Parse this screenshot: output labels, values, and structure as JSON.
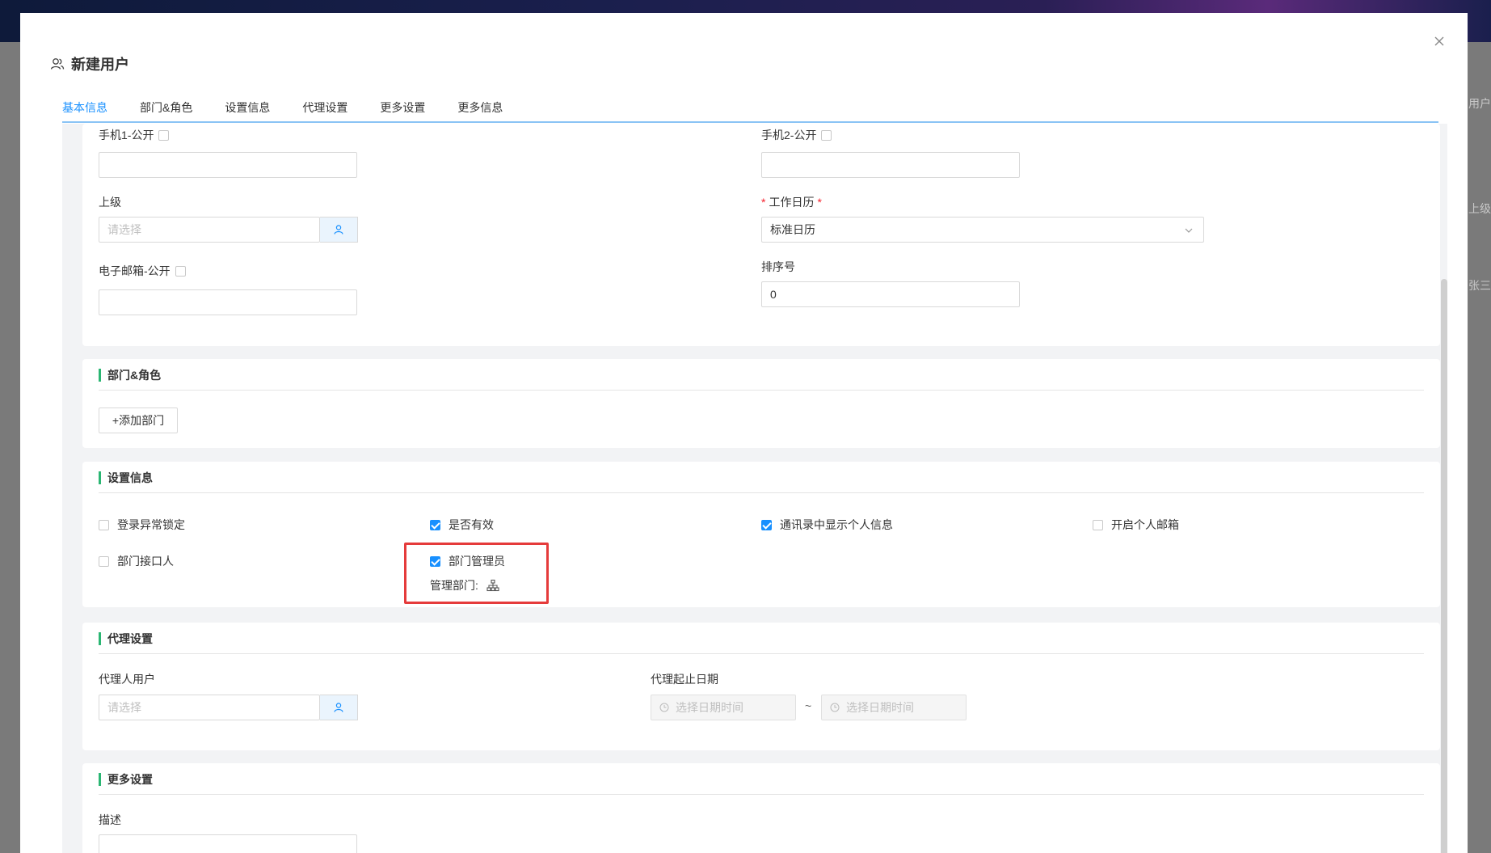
{
  "background": {
    "right_labels": [
      "用户",
      "上级",
      "张三"
    ]
  },
  "dialog": {
    "title": "新建用户",
    "tabs": [
      {
        "label": "基本信息",
        "active": true
      },
      {
        "label": "部门&角色",
        "active": false
      },
      {
        "label": "设置信息",
        "active": false
      },
      {
        "label": "代理设置",
        "active": false
      },
      {
        "label": "更多设置",
        "active": false
      },
      {
        "label": "更多信息",
        "active": false
      }
    ]
  },
  "basic": {
    "phone1_label": "手机1-公开",
    "phone1_public": false,
    "phone1_value": "",
    "phone2_label": "手机2-公开",
    "phone2_public": false,
    "phone2_value": "",
    "superior_label": "上级",
    "superior_placeholder": "请选择",
    "calendar_required": "*",
    "calendar_label": "工作日历",
    "calendar_required_after": "*",
    "calendar_value": "标准日历",
    "email_label": "电子邮箱-公开",
    "email_public": false,
    "email_value": "",
    "sort_label": "排序号",
    "sort_value": "0"
  },
  "dept_role": {
    "title": "部门&角色",
    "add_button": "+添加部门"
  },
  "settings": {
    "title": "设置信息",
    "items": [
      {
        "label": "登录异常锁定",
        "checked": false
      },
      {
        "label": "是否有效",
        "checked": true
      },
      {
        "label": "通讯录中显示个人信息",
        "checked": true
      },
      {
        "label": "开启个人邮箱",
        "checked": false
      },
      {
        "label": "部门接口人",
        "checked": false
      },
      {
        "label": "部门管理员",
        "checked": true
      }
    ],
    "manage_dept_label": "管理部门:"
  },
  "proxy": {
    "title": "代理设置",
    "user_label": "代理人用户",
    "user_placeholder": "请选择",
    "date_label": "代理起止日期",
    "start_placeholder": "选择日期时间",
    "separator": "~",
    "end_placeholder": "选择日期时间"
  },
  "more": {
    "title": "更多设置",
    "desc_label": "描述",
    "desc_value": ""
  },
  "colors": {
    "accent": "#1890ff",
    "section_bar": "#2bb673",
    "highlight": "#e53b3b"
  }
}
